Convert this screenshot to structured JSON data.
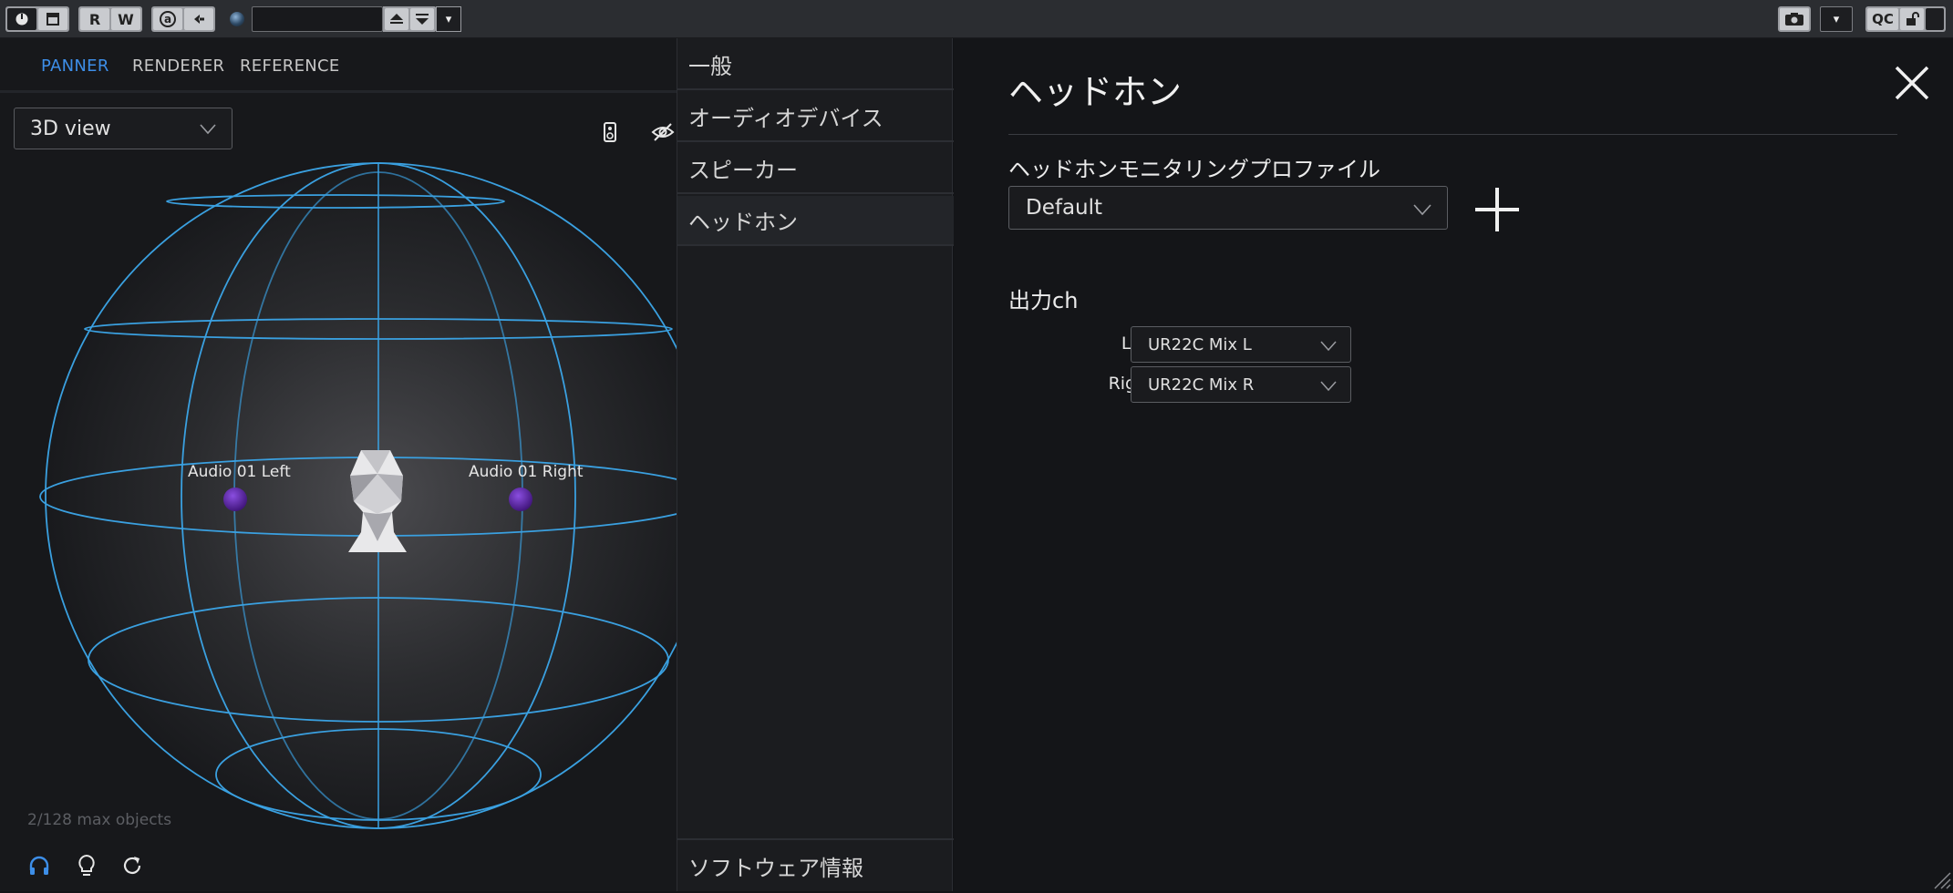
{
  "toolbar": {
    "btn_r": "R",
    "btn_w": "W",
    "btn_a": "a",
    "btn_menu": "▾",
    "btn_qc": "QC",
    "btn_right_menu": "▾"
  },
  "panner": {
    "tabs": [
      {
        "label": "PANNER",
        "active": true
      },
      {
        "label": "RENDERER",
        "active": false
      },
      {
        "label": "REFERENCE",
        "active": false
      }
    ],
    "view_select": "3D view",
    "objects": [
      {
        "label": "Audio 01 Left",
        "color": "#5a1fa3"
      },
      {
        "label": "Audio 01 Right",
        "color": "#5a1fa3"
      }
    ],
    "status": "2/128 max objects",
    "accent_color": "#3d8ee8",
    "sphere_color": "#3aa0e0",
    "bottom_icons": [
      "headphones-icon",
      "lightbulb-icon",
      "reset-icon"
    ]
  },
  "nav": {
    "items": [
      {
        "label": "一般",
        "selected": false
      },
      {
        "label": "オーディオデバイス",
        "selected": false
      },
      {
        "label": "スピーカー",
        "selected": false
      },
      {
        "label": "ヘッドホン",
        "selected": true
      }
    ],
    "footer": "ソフトウェア情報"
  },
  "content": {
    "title": "ヘッドホン",
    "profile_label": "ヘッドホンモニタリングプロファイル",
    "profile_value": "Default",
    "output_label": "出力ch",
    "left_label": "Left:",
    "left_value": "UR22C Mix L",
    "right_label": "Right:",
    "right_value": "UR22C Mix R"
  }
}
